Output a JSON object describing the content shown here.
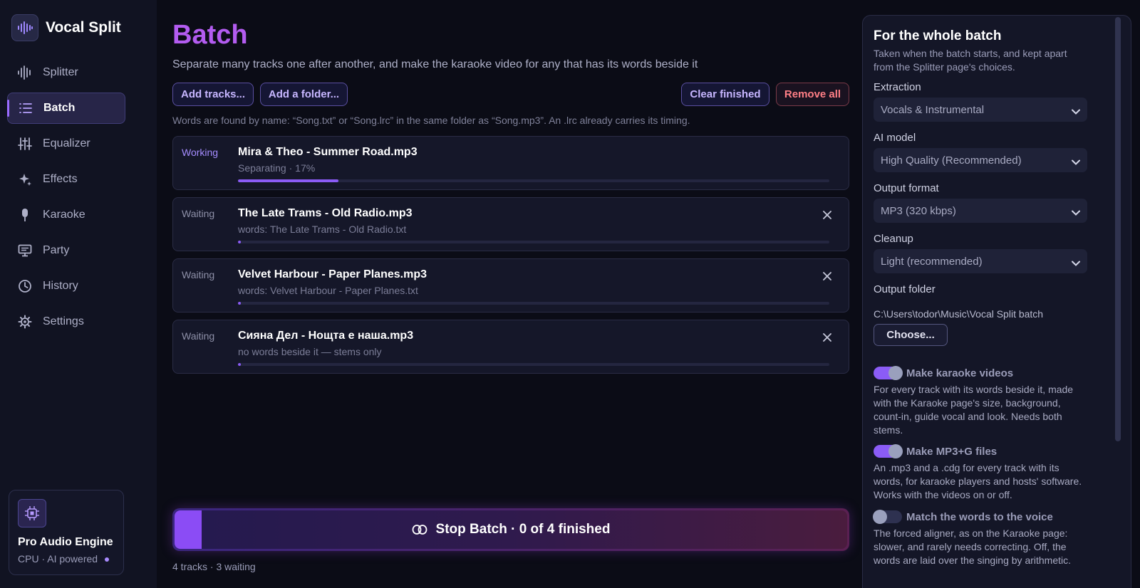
{
  "app": {
    "name": "Vocal Split"
  },
  "nav": {
    "items": [
      {
        "label": "Splitter",
        "icon": "waveform-icon"
      },
      {
        "label": "Batch",
        "icon": "list-icon",
        "active": true
      },
      {
        "label": "Equalizer",
        "icon": "sliders-icon"
      },
      {
        "label": "Effects",
        "icon": "sparkle-icon"
      },
      {
        "label": "Karaoke",
        "icon": "microphone-icon"
      },
      {
        "label": "Party",
        "icon": "monitor-icon"
      },
      {
        "label": "History",
        "icon": "clock-icon"
      },
      {
        "label": "Settings",
        "icon": "gear-icon"
      }
    ]
  },
  "engine": {
    "title": "Pro Audio Engine",
    "subtitle": "CPU · AI powered"
  },
  "main": {
    "title": "Batch",
    "description": "Separate many tracks one after another, and make the karaoke video for any that has its words beside it",
    "buttons": {
      "add_tracks": "Add tracks...",
      "add_folder": "Add a folder...",
      "clear_finished": "Clear finished",
      "remove_all": "Remove all"
    },
    "hint": "Words are found by name: “Song.txt” or “Song.lrc” in the same folder as “Song.mp3”. An .lrc already carries its timing.",
    "jobs": [
      {
        "status": "Working",
        "name": "Mira & Theo - Summer Road.mp3",
        "detail": "Separating · 17%",
        "progress": 0.17
      },
      {
        "status": "Waiting",
        "name": "The Late Trams - Old Radio.mp3",
        "detail": "words: The Late Trams - Old Radio.txt",
        "progress": 0
      },
      {
        "status": "Waiting",
        "name": "Velvet Harbour - Paper Planes.mp3",
        "detail": "words: Velvet Harbour - Paper Planes.txt",
        "progress": 0
      },
      {
        "status": "Waiting",
        "name": "Сияна Дел - Нощта е наша.mp3",
        "detail": "no words beside it — stems only",
        "progress": 0
      }
    ],
    "stop_button": "Stop Batch · 0 of 4 finished",
    "stop_progress": 0.04,
    "footer": "4 tracks · 3 waiting"
  },
  "panel": {
    "title": "For the whole batch",
    "subtitle": "Taken when the batch starts, and kept apart from the Splitter page's choices.",
    "extraction": {
      "label": "Extraction",
      "value": "Vocals & Instrumental"
    },
    "model": {
      "label": "AI model",
      "value": "High Quality (Recommended)"
    },
    "format": {
      "label": "Output format",
      "value": "MP3 (320 kbps)"
    },
    "cleanup": {
      "label": "Cleanup",
      "value": "Light (recommended)"
    },
    "output_folder": {
      "label": "Output folder",
      "path": "C:\\Users\\todor\\Music\\Vocal Split batch",
      "button": "Choose..."
    },
    "toggles": [
      {
        "label": "Make karaoke videos",
        "on": true,
        "description": "For every track with its words beside it, made with the Karaoke page's size, background, count-in, guide vocal and look. Needs both stems."
      },
      {
        "label": "Make MP3+G files",
        "on": true,
        "description": "An .mp3 and a .cdg for every track with its words, for karaoke players and hosts' software. Works with the videos on or off."
      },
      {
        "label": "Match the words to the voice",
        "on": false,
        "description": "The forced aligner, as on the Karaoke page: slower, and rarely needs correcting. Off, the words are laid over the singing by arithmetic."
      }
    ]
  },
  "colors": {
    "accent": "#8b5cf6",
    "danger": "#ff7f86",
    "background": "#0b0c16"
  }
}
